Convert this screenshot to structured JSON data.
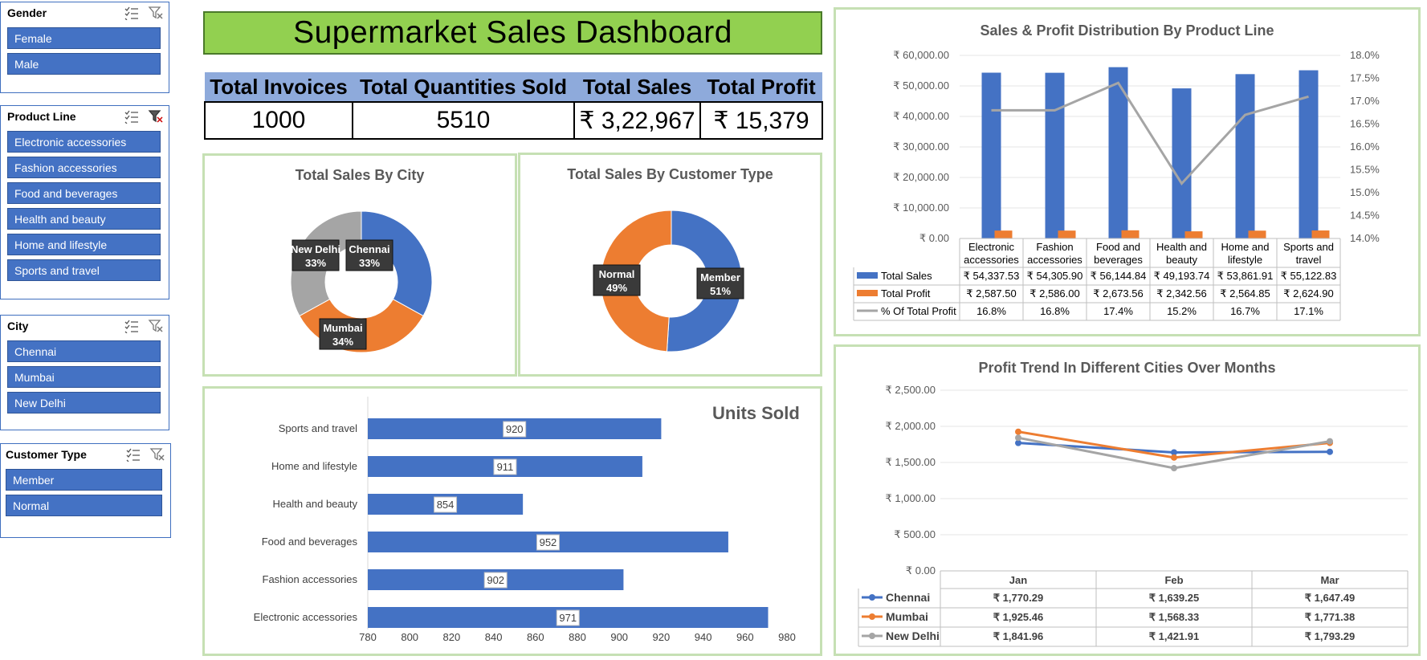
{
  "slicers": {
    "gender": {
      "title": "Gender",
      "items": [
        "Female",
        "Male"
      ]
    },
    "product_line": {
      "title": "Product Line",
      "items": [
        "Electronic accessories",
        "Fashion accessories",
        "Food and beverages",
        "Health and beauty",
        "Home and lifestyle",
        "Sports and travel"
      ]
    },
    "city": {
      "title": "City",
      "items": [
        "Chennai",
        "Mumbai",
        "New Delhi"
      ]
    },
    "customer_type": {
      "title": "Customer Type",
      "items": [
        "Member",
        "Normal"
      ]
    }
  },
  "dashboard": {
    "title": "Supermarket Sales Dashboard"
  },
  "kpis": {
    "headers": [
      "Total Invoices",
      "Total Quantities Sold",
      "Total Sales",
      "Total Profit"
    ],
    "values": [
      "1000",
      "5510",
      "₹ 3,22,967",
      "₹ 15,379"
    ]
  },
  "colors": {
    "blue": "#4472c4",
    "orange": "#ed7d31",
    "gray": "#a5a5a5",
    "green_title": "#92d050",
    "kpi_header": "#8eaadb"
  },
  "chart_data": [
    {
      "id": "sales_by_city",
      "type": "pie",
      "title": "Total Sales By City",
      "labels": [
        "Chennai",
        "Mumbai",
        "New Delhi"
      ],
      "values": [
        33,
        34,
        33
      ],
      "value_labels": [
        "33%",
        "34%",
        "33%"
      ],
      "colors": [
        "#4472c4",
        "#ed7d31",
        "#a5a5a5"
      ]
    },
    {
      "id": "sales_by_customer_type",
      "type": "pie",
      "title": "Total Sales By Customer Type",
      "labels": [
        "Member",
        "Normal"
      ],
      "values": [
        51,
        49
      ],
      "value_labels": [
        "51%",
        "49%"
      ],
      "colors": [
        "#4472c4",
        "#ed7d31"
      ]
    },
    {
      "id": "units_sold",
      "type": "bar",
      "orientation": "horizontal",
      "title": "Units Sold",
      "categories": [
        "Sports and travel",
        "Home and lifestyle",
        "Health and beauty",
        "Food and beverages",
        "Fashion accessories",
        "Electronic accessories"
      ],
      "values": [
        920,
        911,
        854,
        952,
        902,
        971
      ],
      "xlim": [
        780,
        980
      ],
      "xticks": [
        "780",
        "800",
        "820",
        "840",
        "860",
        "880",
        "900",
        "920",
        "940",
        "960",
        "980"
      ]
    },
    {
      "id": "product_line_dist",
      "type": "bar",
      "title": "Sales & Profit Distribution By Product Line",
      "categories": [
        [
          "Electronic",
          "accessories"
        ],
        [
          "Fashion",
          "accessories"
        ],
        [
          "Food and",
          "beverages"
        ],
        [
          "Health and",
          "beauty"
        ],
        [
          "Home and",
          "lifestyle"
        ],
        [
          "Sports and",
          "travel"
        ]
      ],
      "series": [
        {
          "name": "Total Sales",
          "type": "bar",
          "values": [
            54337.53,
            54305.9,
            56144.84,
            49193.74,
            53861.91,
            55122.83
          ],
          "labels": [
            "₹ 54,337.53",
            "₹ 54,305.90",
            "₹ 56,144.84",
            "₹ 49,193.74",
            "₹ 53,861.91",
            "₹ 55,122.83"
          ]
        },
        {
          "name": "Total Profit",
          "type": "bar",
          "values": [
            2587.5,
            2586.0,
            2673.56,
            2342.56,
            2564.85,
            2624.9
          ],
          "labels": [
            "₹ 2,587.50",
            "₹ 2,586.00",
            "₹ 2,673.56",
            "₹ 2,342.56",
            "₹ 2,564.85",
            "₹ 2,624.90"
          ]
        },
        {
          "name": "% Of Total Profit",
          "type": "line",
          "axis": "secondary",
          "values": [
            16.8,
            16.8,
            17.4,
            15.2,
            16.7,
            17.1
          ],
          "labels": [
            "16.8%",
            "16.8%",
            "17.4%",
            "15.2%",
            "16.7%",
            "17.1%"
          ]
        }
      ],
      "ylim": [
        0,
        60000
      ],
      "yticks": [
        "₹ 0.00",
        "₹ 10,000.00",
        "₹ 20,000.00",
        "₹ 30,000.00",
        "₹ 40,000.00",
        "₹ 50,000.00",
        "₹ 60,000.00"
      ],
      "y2lim": [
        14.0,
        18.0
      ],
      "y2ticks": [
        "14.0%",
        "14.5%",
        "15.0%",
        "15.5%",
        "16.0%",
        "16.5%",
        "17.0%",
        "17.5%",
        "18.0%"
      ]
    },
    {
      "id": "profit_trend",
      "type": "line",
      "title": "Profit Trend In Different Cities Over Months",
      "categories": [
        "Jan",
        "Feb",
        "Mar"
      ],
      "series": [
        {
          "name": "Chennai",
          "values": [
            1770.29,
            1639.25,
            1647.49
          ],
          "labels": [
            "₹ 1,770.29",
            "₹ 1,639.25",
            "₹ 1,647.49"
          ],
          "color": "#4472c4"
        },
        {
          "name": "Mumbai",
          "values": [
            1925.46,
            1568.33,
            1771.38
          ],
          "labels": [
            "₹ 1,925.46",
            "₹ 1,568.33",
            "₹ 1,771.38"
          ],
          "color": "#ed7d31"
        },
        {
          "name": "New Delhi",
          "values": [
            1841.96,
            1421.91,
            1793.29
          ],
          "labels": [
            "₹ 1,841.96",
            "₹ 1,421.91",
            "₹ 1,793.29"
          ],
          "color": "#a5a5a5"
        }
      ],
      "ylim": [
        0,
        2500
      ],
      "yticks": [
        "₹ 0.00",
        "₹ 500.00",
        "₹ 1,000.00",
        "₹ 1,500.00",
        "₹ 2,000.00",
        "₹ 2,500.00"
      ]
    }
  ]
}
